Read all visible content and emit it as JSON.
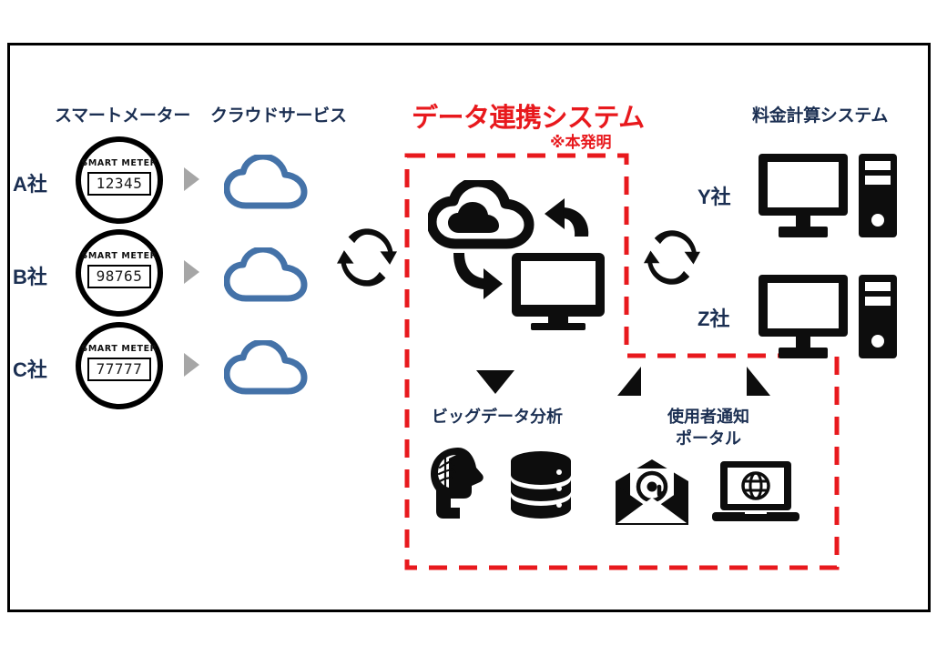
{
  "diagram": {
    "headers": {
      "smart_meter": "スマートメーター",
      "cloud_service": "クラウドサービス",
      "billing_system": "料金計算システム"
    },
    "center": {
      "title": "データ連携システム",
      "subtitle": "※本発明"
    },
    "utilities": [
      {
        "label": "A社",
        "meter_title": "SMART  METER",
        "meter_value": "12345"
      },
      {
        "label": "B社",
        "meter_title": "SMART  METER",
        "meter_value": "98765"
      },
      {
        "label": "C社",
        "meter_title": "SMART  METER",
        "meter_value": "77777"
      }
    ],
    "billing_companies": [
      {
        "label": "Y社"
      },
      {
        "label": "Z社"
      }
    ],
    "modules": [
      {
        "label": "ビッグデータ分析"
      },
      {
        "label_line1": "使用者通知",
        "label_line2": "ポータル"
      }
    ],
    "icons": {
      "cloud": "cloud-icon",
      "gray_arrow": "gray-triangle-arrow-icon",
      "sync": "sync-arrows-icon",
      "cloud_monitor": "cloud-monitor-sync-icon",
      "brain_head": "brain-head-icon",
      "database": "database-icon",
      "email": "email-at-icon",
      "laptop_globe": "laptop-globe-icon",
      "desktop_pc": "desktop-pc-tower-icon"
    },
    "colors": {
      "accent_red": "#e8191d",
      "navy_text": "#1b2f52",
      "cloud_blue": "#4472a8",
      "gray_arrow": "#a6a6a6",
      "black": "#0d0d0d"
    }
  }
}
